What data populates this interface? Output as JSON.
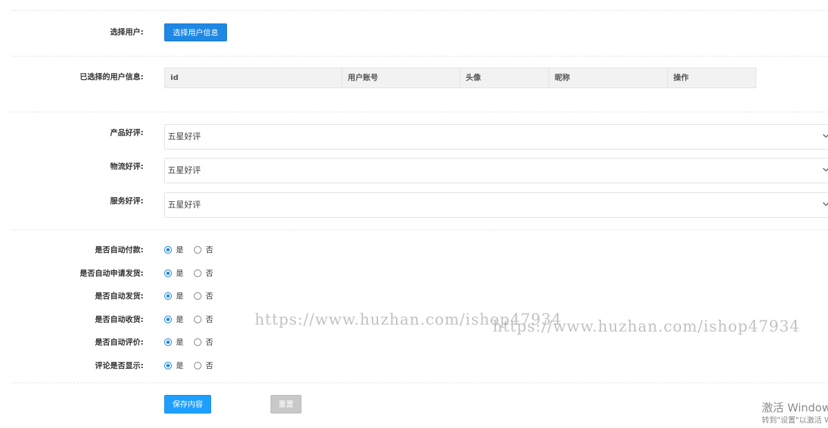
{
  "user_select": {
    "label": "选择用户:",
    "button_label": "选择用户信息"
  },
  "selected_users": {
    "label": "已选择的用户信息:",
    "columns": [
      "id",
      "用户账号",
      "头像",
      "昵称",
      "操作"
    ]
  },
  "ratings": [
    {
      "label": "产品好评:",
      "value": "五星好评"
    },
    {
      "label": "物流好评:",
      "value": "五星好评"
    },
    {
      "label": "服务好评:",
      "value": "五星好评"
    }
  ],
  "toggles": [
    {
      "label": "是否自动付款:",
      "yes": "是",
      "no": "否",
      "selected": "是"
    },
    {
      "label": "是否自动申请发货:",
      "yes": "是",
      "no": "否",
      "selected": "是"
    },
    {
      "label": "是否自动发货:",
      "yes": "是",
      "no": "否",
      "selected": "是"
    },
    {
      "label": "是否自动收货:",
      "yes": "是",
      "no": "否",
      "selected": "是"
    },
    {
      "label": "是否自动评价:",
      "yes": "是",
      "no": "否",
      "selected": "是"
    },
    {
      "label": "评论是否显示:",
      "yes": "是",
      "no": "否",
      "selected": "是"
    }
  ],
  "actions": {
    "save_label": "保存内容",
    "reset_label": "重置"
  },
  "watermark": {
    "text1": "https://www.huzhan.com/ishop47934",
    "text2": "https://www.huzhan.com/ishop47934"
  },
  "windows_activation": {
    "title": "激活 Windows",
    "subtitle": "转到\"设置\"以激活 Windows。"
  },
  "colors": {
    "primary": "#1e88e5",
    "save": "#1e9fff",
    "reset": "#c8c8c8"
  }
}
